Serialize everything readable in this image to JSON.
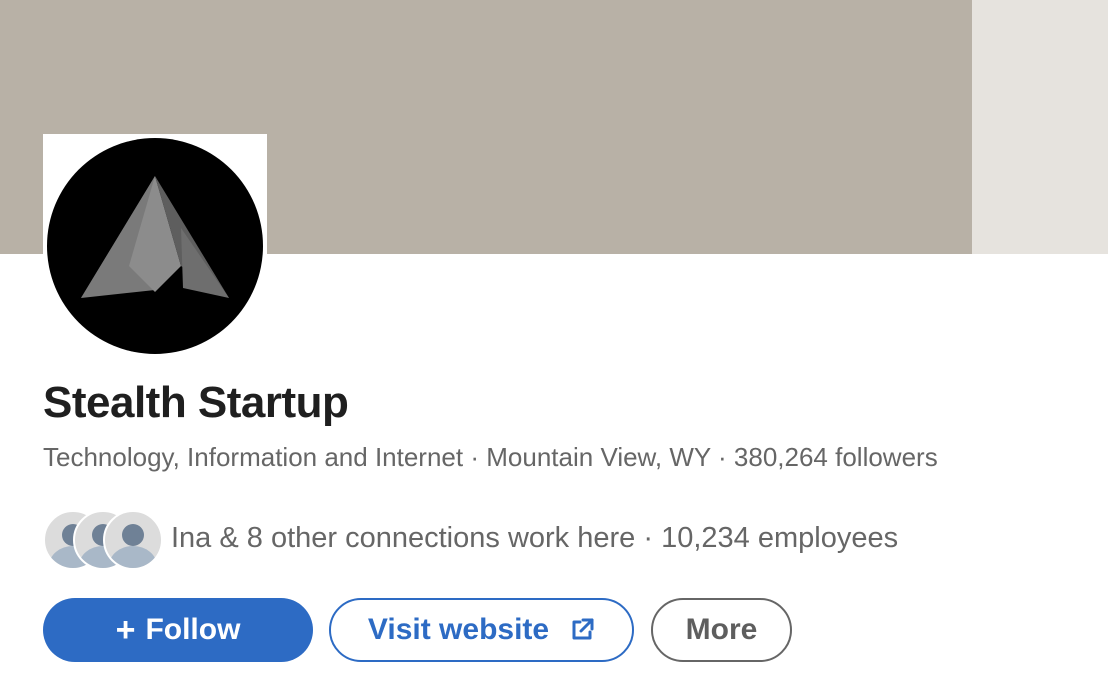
{
  "company": {
    "name": "Stealth Startup",
    "industry": "Technology, Information and Internet",
    "location": "Mountain View, WY",
    "followers": "380,264 followers",
    "separator": "·"
  },
  "connections": {
    "text": "Ina & 8 other connections work here",
    "separator": "·",
    "employees": "10,234 employees"
  },
  "actions": {
    "follow_icon": "+",
    "follow_label": "Follow",
    "visit_label": "Visit website",
    "more_label": "More"
  },
  "colors": {
    "banner": "#b8b1a6",
    "accent": "#2d6bc4",
    "text_primary": "#1f1f1f",
    "text_secondary": "#666666"
  },
  "icons": {
    "logo": "stealth-arrow-logo",
    "follow": "plus-icon",
    "visit": "external-link-icon",
    "avatars": "person-avatar-icon"
  }
}
